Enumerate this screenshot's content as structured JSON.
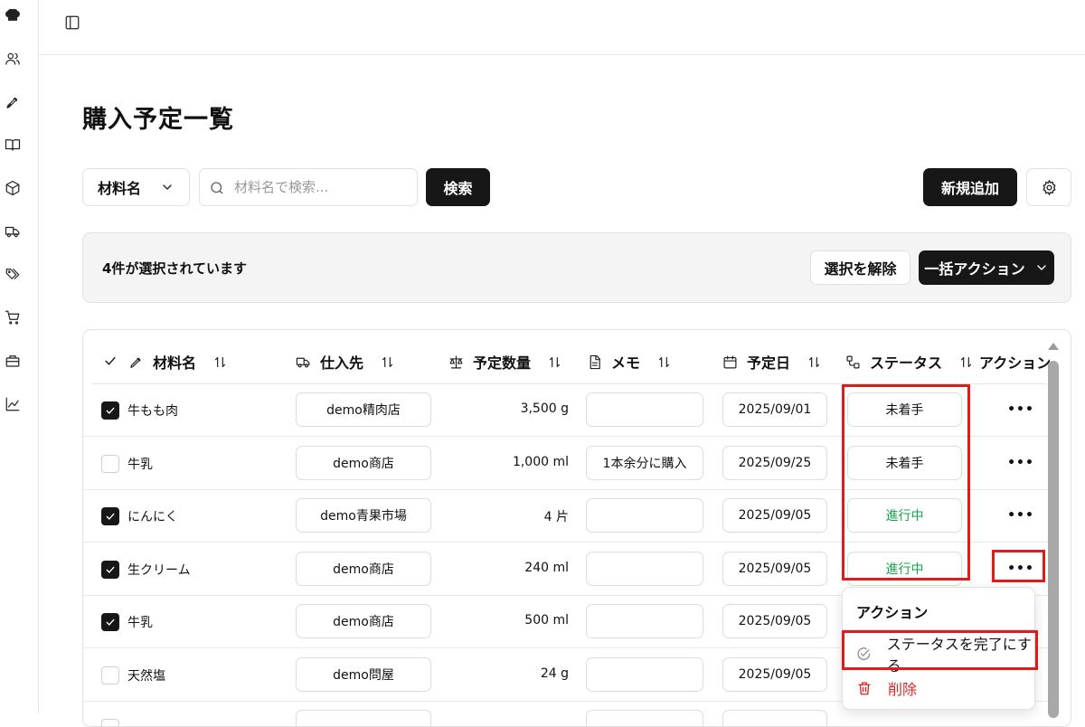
{
  "page": {
    "title": "購入予定一覧"
  },
  "toolbar": {
    "field_select": "材料名",
    "search_placeholder": "材料名で検索...",
    "search_button": "検索",
    "add_button": "新規追加"
  },
  "selection": {
    "count_text": "4件が選択されています",
    "clear_button": "選択を解除",
    "bulk_action_button": "一括アクション"
  },
  "table": {
    "headers": {
      "name": "材料名",
      "supplier": "仕入先",
      "quantity": "予定数量",
      "memo": "メモ",
      "date": "予定日",
      "status": "ステータス",
      "action": "アクション"
    },
    "rows": [
      {
        "checked": true,
        "name": "牛もも肉",
        "supplier": "demo精肉店",
        "quantity": "3,500 g",
        "memo": "",
        "date": "2025/09/01",
        "status": "未着手",
        "status_type": "todo"
      },
      {
        "checked": false,
        "name": "牛乳",
        "supplier": "demo商店",
        "quantity": "1,000 ml",
        "memo": "1本余分に購入",
        "date": "2025/09/25",
        "status": "未着手",
        "status_type": "todo"
      },
      {
        "checked": true,
        "name": "にんにく",
        "supplier": "demo青果市場",
        "quantity": "4 片",
        "memo": "",
        "date": "2025/09/05",
        "status": "進行中",
        "status_type": "progress"
      },
      {
        "checked": true,
        "name": "生クリーム",
        "supplier": "demo商店",
        "quantity": "240 ml",
        "memo": "",
        "date": "2025/09/05",
        "status": "進行中",
        "status_type": "progress"
      },
      {
        "checked": true,
        "name": "牛乳",
        "supplier": "demo商店",
        "quantity": "500 ml",
        "memo": "",
        "date": "2025/09/05",
        "status": "",
        "status_type": "hidden"
      },
      {
        "checked": false,
        "name": "天然塩",
        "supplier": "demo問屋",
        "quantity": "24 g",
        "memo": "",
        "date": "2025/09/05",
        "status": "",
        "status_type": "hidden"
      },
      {
        "checked": false,
        "name": "",
        "supplier": "",
        "quantity": "",
        "memo": "",
        "date": "",
        "status": "",
        "status_type": "hidden"
      }
    ]
  },
  "action_menu": {
    "title": "アクション",
    "complete": "ステータスを完了にする",
    "delete": "削除"
  },
  "colors": {
    "accent": "#171717",
    "progress": "#16a34a",
    "danger": "#dc2626",
    "highlight": "#e01b1b"
  },
  "sidebar_icons": [
    "chef-hat-icon",
    "users-icon",
    "pen-icon",
    "book-icon",
    "package-icon",
    "truck-icon",
    "tags-icon",
    "cart-icon",
    "briefcase-icon",
    "chart-icon"
  ]
}
